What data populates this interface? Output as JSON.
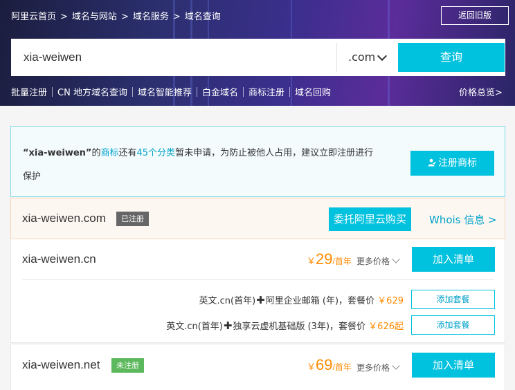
{
  "breadcrumb": {
    "items": [
      "阿里云首页",
      "域名与网站",
      "域名服务",
      "域名查询"
    ],
    "separator": ">"
  },
  "back_old_label": "返回旧版",
  "search": {
    "value": "xia-weiwen",
    "suffix": ".com",
    "button_label": "查询"
  },
  "quick_links": [
    "批量注册",
    "CN 地方域名查询",
    "域名智能推荐",
    "白金域名",
    "商标注册",
    "域名回购"
  ],
  "price_overview": "价格总览>",
  "notice": {
    "quoted_name": "“xia-weiwen”",
    "text_1": "的",
    "trademark_link": "商标",
    "text_2": "还有",
    "category_link": "45个分类",
    "text_3": "暂未申请，为防止被他人占用，建议立即注册进行",
    "text_4": "保护",
    "button_label": "注册商标"
  },
  "registered": {
    "domain": "xia-weiwen.com",
    "badge": "已注册",
    "broker_button": "委托阿里云购买",
    "whois_link": "Whois 信息 >"
  },
  "cn": {
    "domain": "xia-weiwen.cn",
    "currency": "￥",
    "price": "29",
    "unit": "/首年",
    "more_price": "更多价格",
    "cart_button": "加入清单",
    "bundles": [
      {
        "left": "英文.cn(首年)",
        "plus": "✚",
        "right": "阿里企业邮箱 (年)，套餐价",
        "price": "￥629",
        "button": "添加套餐"
      },
      {
        "left": "英文.cn(首年)",
        "plus": "✚",
        "right": "独享云虚机基础版 (3年)，套餐价",
        "price": "￥626起",
        "button": "添加套餐"
      }
    ]
  },
  "net": {
    "domain": "xia-weiwen.net",
    "badge": "未注册",
    "currency": "￥",
    "price": "69",
    "unit": "/首年",
    "more_price": "更多价格",
    "cart_button": "加入清单"
  },
  "colors": {
    "accent": "#00c1de",
    "price": "#ff8a00",
    "link": "#00a2ca",
    "registered_badge": "#666666",
    "available_badge": "#5cb85c"
  }
}
